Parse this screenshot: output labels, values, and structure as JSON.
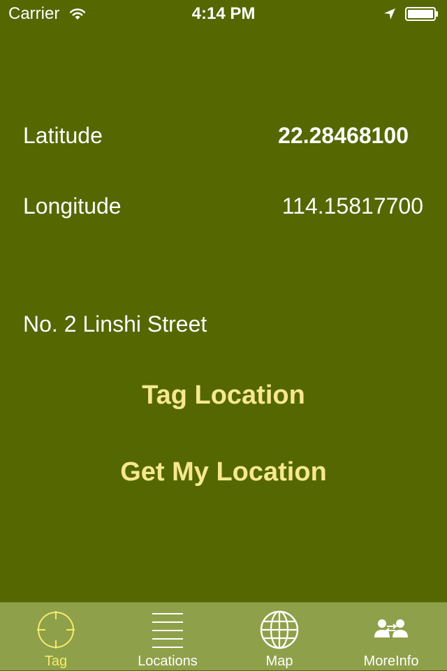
{
  "status_bar": {
    "carrier": "Carrier",
    "time": "4:14 PM"
  },
  "coordinates": {
    "latitude_label": "Latitude",
    "latitude_value": "22.28468100",
    "longitude_label": "Longitude",
    "longitude_value": "114.15817700"
  },
  "address": "No. 2 Linshi Street",
  "buttons": {
    "tag_location": "Tag Location",
    "get_my_location": "Get My Location"
  },
  "tab_bar": {
    "selected": "Tag",
    "tabs": [
      {
        "label": "Tag",
        "icon": "crosshair-icon"
      },
      {
        "label": "Locations",
        "icon": "list-lines-icon"
      },
      {
        "label": "Map",
        "icon": "globe-icon"
      },
      {
        "label": "MoreInfo",
        "icon": "people-icon"
      }
    ]
  },
  "colors": {
    "background": "#546700",
    "tab_bar": "#8fa04a",
    "button_text": "#f7e88d",
    "selected_tab": "#f5ec6a"
  }
}
